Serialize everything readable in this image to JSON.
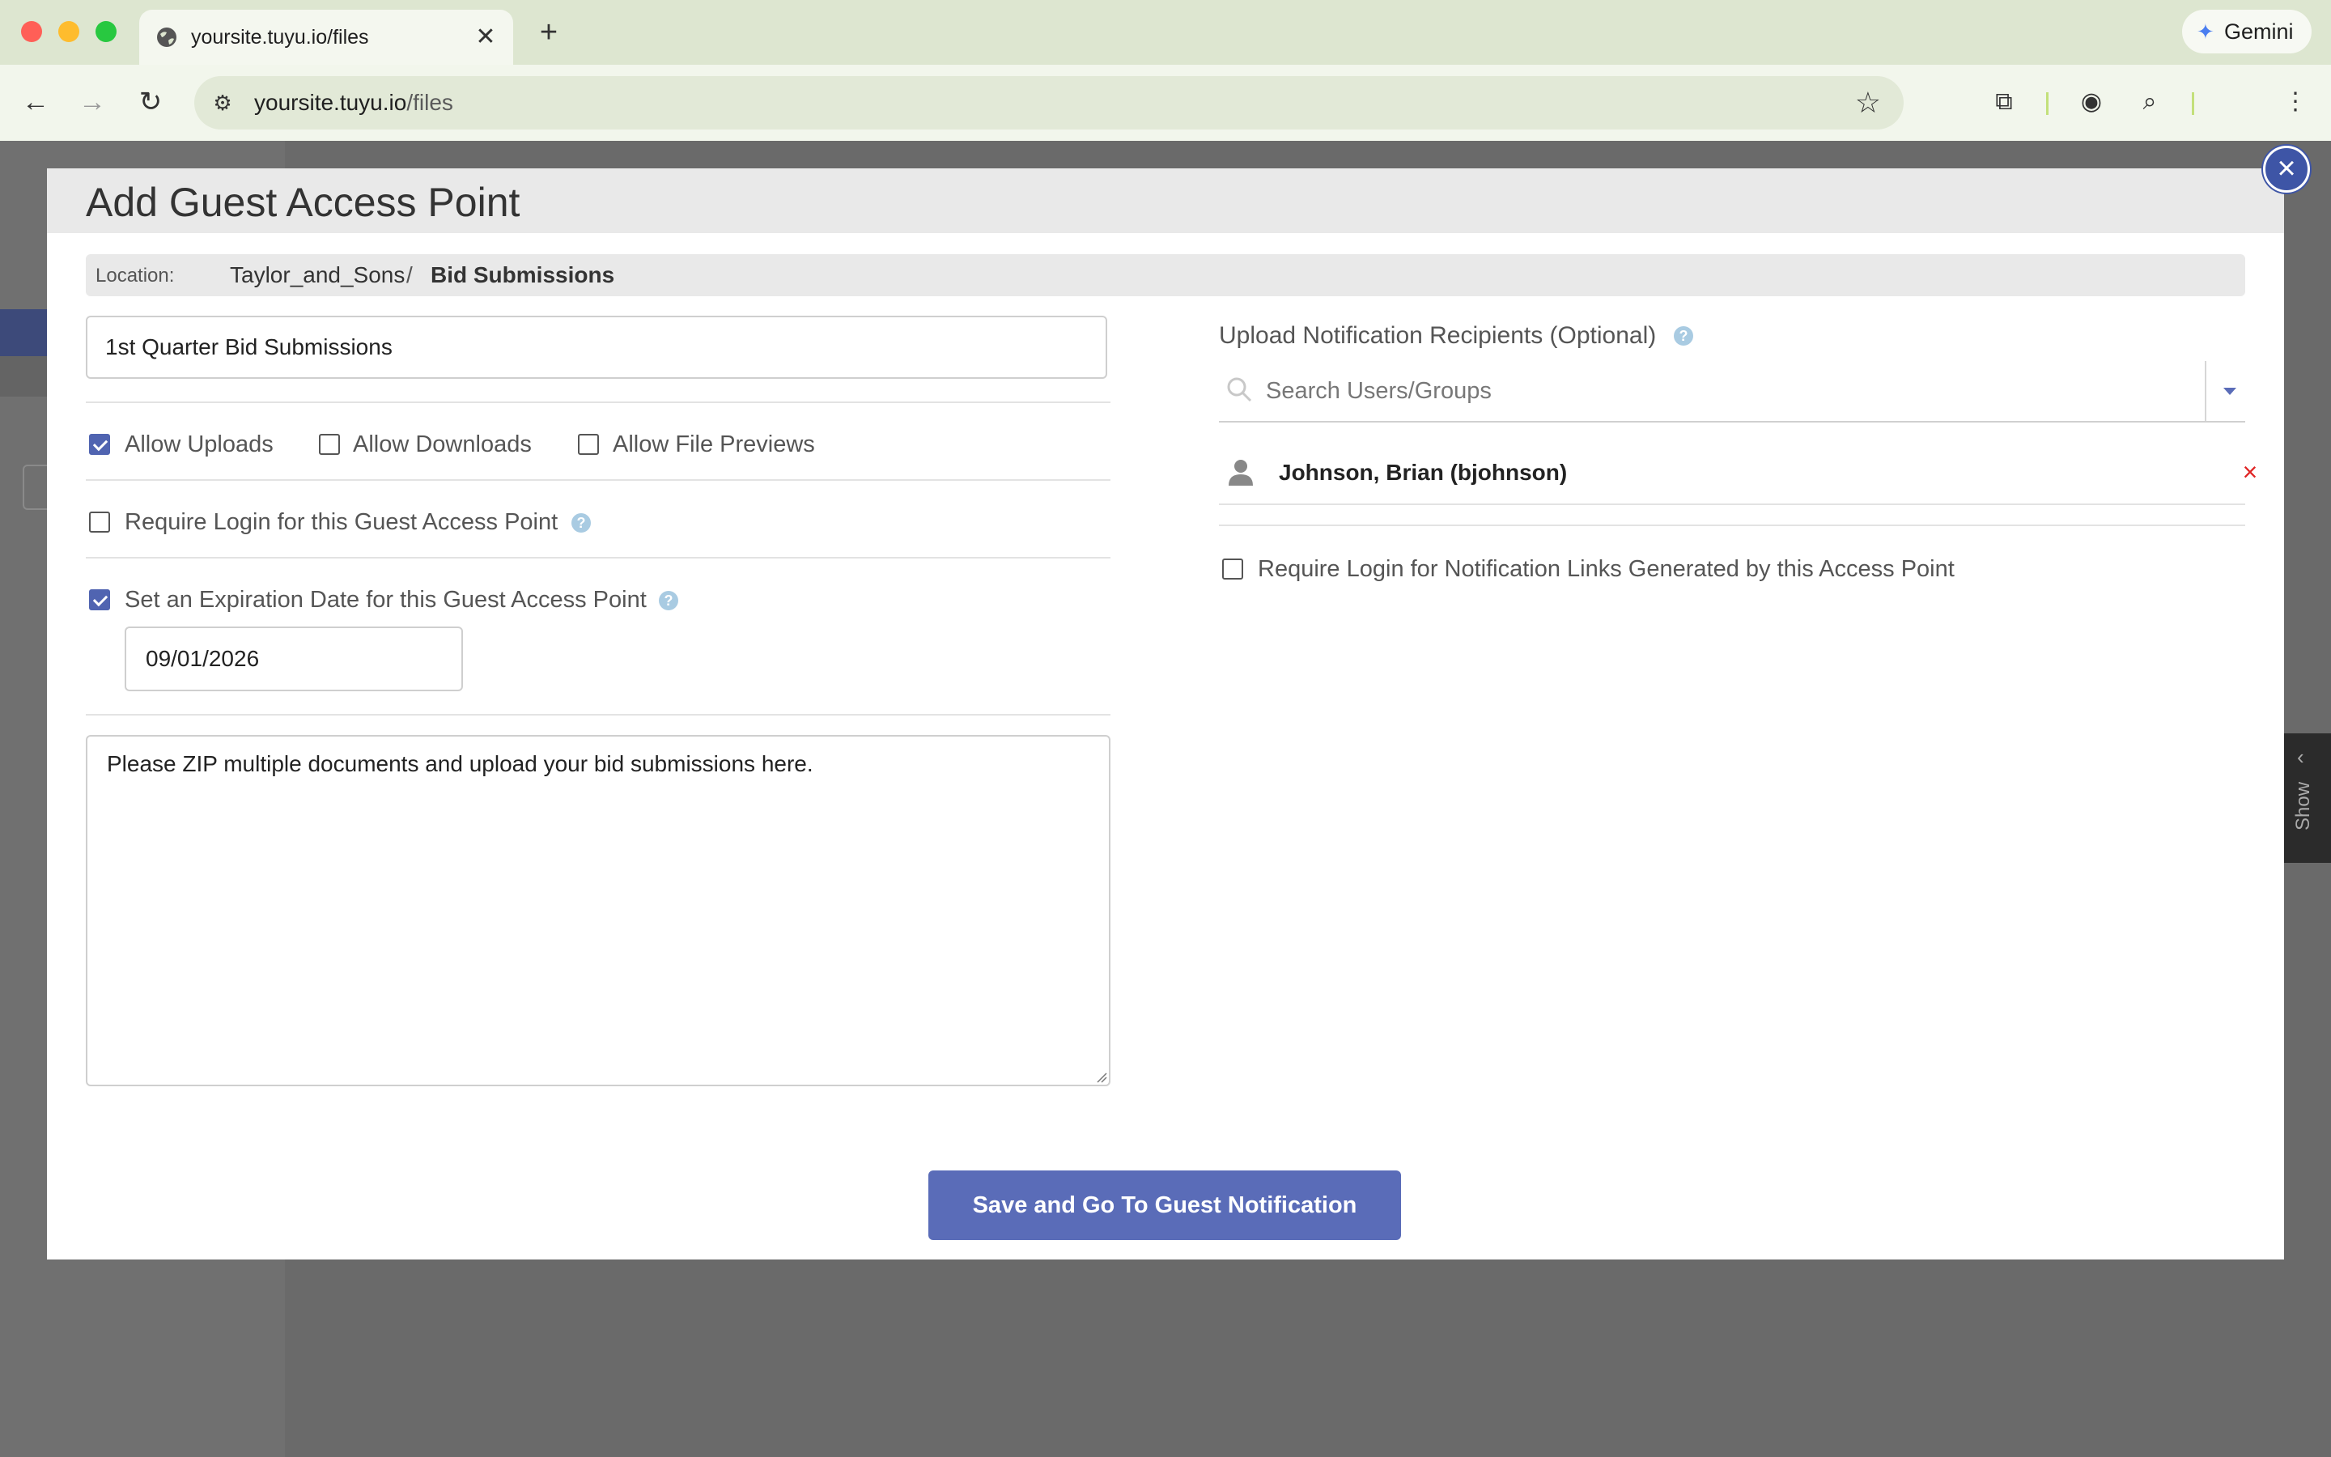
{
  "browser": {
    "tab_title": "yoursite.tuyu.io/files",
    "url_host": "yoursite.tuyu.io",
    "url_path": "/files",
    "gemini_label": "Gemini",
    "new_tab_symbol": "+",
    "tab_close_symbol": "✕"
  },
  "background": {
    "show_panel_label": "Show"
  },
  "dialog": {
    "title": "Add Guest Access Point",
    "location": {
      "label": "Location:",
      "parent": "Taylor_and_Sons",
      "separator": "/",
      "current": "Bid Submissions"
    },
    "name_value": "1st Quarter Bid Submissions",
    "permissions": [
      {
        "label": "Allow Uploads",
        "checked": true
      },
      {
        "label": "Allow Downloads",
        "checked": false
      },
      {
        "label": "Allow File Previews",
        "checked": false
      }
    ],
    "require_login": {
      "label": "Require Login for this Guest Access Point",
      "checked": false
    },
    "expiration": {
      "label": "Set an Expiration Date for this Guest Access Point",
      "checked": true,
      "date": "09/01/2026"
    },
    "message": "Please ZIP multiple documents and upload your bid submissions here.",
    "recipients": {
      "label": "Upload Notification Recipients (Optional)",
      "search_placeholder": "Search Users/Groups",
      "items": [
        {
          "name": "Johnson, Brian (bjohnson)"
        }
      ]
    },
    "notification_login": {
      "label": "Require Login for Notification Links Generated by this Access Point",
      "checked": false
    },
    "help_symbol": "?",
    "save_label": "Save and Go To Guest Notification"
  },
  "colors": {
    "accent": "#5a6cb8",
    "checkbox_checked": "#5064b1",
    "remove": "#e02424",
    "help": "#a9cbe2"
  },
  "icons": [
    "globe-icon",
    "back-arrow-icon",
    "forward-arrow-icon",
    "reload-icon",
    "site-settings-icon",
    "star-icon",
    "extensions-icon",
    "screenshot-icon",
    "lens-icon",
    "more-vert-icon",
    "close-icon",
    "help-icon",
    "search-icon",
    "chevron-down-icon",
    "user-icon",
    "remove-icon",
    "gemini-star-icon"
  ]
}
